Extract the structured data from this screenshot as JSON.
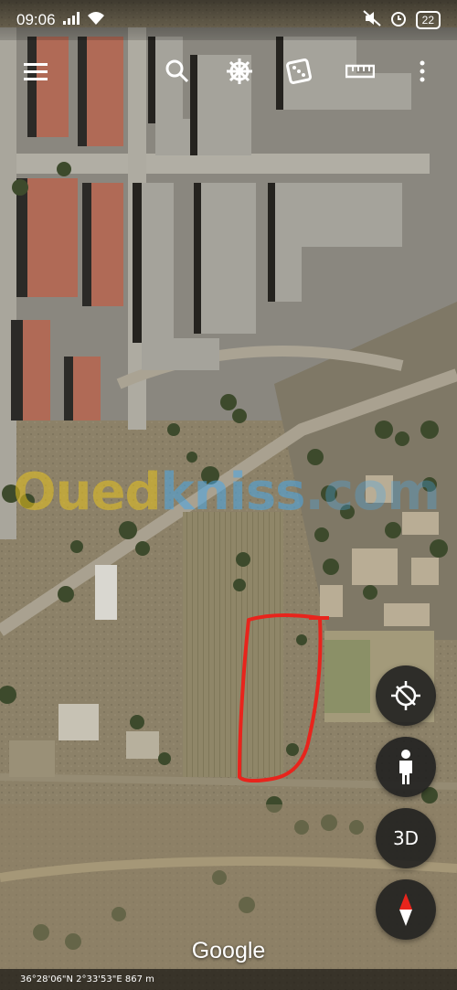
{
  "status_bar": {
    "time": "09:06",
    "battery": "22",
    "icons": [
      "signal-icon",
      "wifi-icon",
      "mute-icon",
      "alarm-icon",
      "battery-icon"
    ]
  },
  "toolbar": {
    "icons": [
      "menu-icon",
      "search-icon",
      "ship-wheel-icon",
      "dice-icon",
      "ruler-icon",
      "more-vert-icon"
    ]
  },
  "watermark": {
    "part_a": "Oued",
    "part_b": "kniss",
    "part_c": ".com"
  },
  "fabs": {
    "three_d_label": "3D"
  },
  "brand": "Google",
  "coordinates": "36°28'06\"N 2°33'53\"E 867 m",
  "colors": {
    "outline": "#e8241c",
    "fab_bg": "#1e1e1e",
    "watermark_yellow": "#e8c31e",
    "watermark_blue": "#4aa8e8"
  }
}
